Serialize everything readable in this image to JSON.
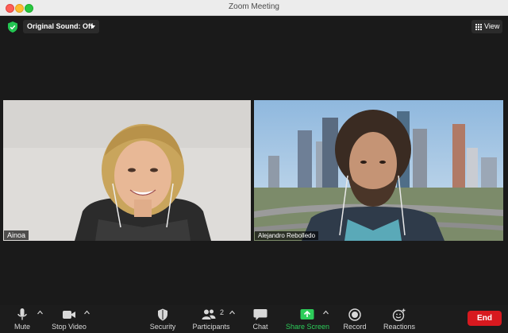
{
  "window": {
    "title": "Zoom Meeting"
  },
  "header": {
    "original_sound_label": "Original Sound: Off",
    "view_label": "View"
  },
  "participants": [
    {
      "name": "Ainoa"
    },
    {
      "name": "Alejandro Rebolledo"
    }
  ],
  "toolbar": {
    "mute_label": "Mute",
    "stop_video_label": "Stop Video",
    "security_label": "Security",
    "participants_label": "Participants",
    "participants_count": "2",
    "chat_label": "Chat",
    "share_screen_label": "Share Screen",
    "record_label": "Record",
    "reactions_label": "Reactions",
    "end_label": "End"
  },
  "colors": {
    "accent_green": "#2dcd5a",
    "end_red": "#d7191f",
    "shield_green": "#23c552"
  }
}
